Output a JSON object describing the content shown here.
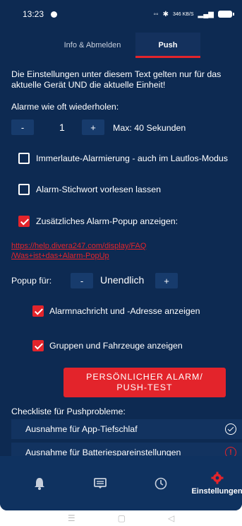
{
  "statusbar": {
    "time": "13:23",
    "network_speed": "346 KB/S"
  },
  "tabs": [
    {
      "label": "Info & Abmelden"
    },
    {
      "label": "Push"
    }
  ],
  "intro_text": "Die Einstellungen unter diesem Text gelten nur für das aktuelle Gerät UND die aktuelle Einheit!",
  "repeat": {
    "label": "Alarme wie oft wiederholen:",
    "minus_label": "-",
    "value": "1",
    "plus_label": "+",
    "max_text": "Max: 40 Sekunden"
  },
  "options": [
    {
      "label": "Immerlaute-Alarmierung - auch im Lautlos-Modus",
      "checked": false
    },
    {
      "label": "Alarm-Stichwort vorlesen lassen",
      "checked": false
    },
    {
      "label": "Zusätzliches Alarm-Popup anzeigen:",
      "checked": true
    }
  ],
  "help_link": "https://help.divera247.com/display/FAQ/Was+ist+das+Alarm-PopUp",
  "help_link_line1": "https://help.divera247.com/display/FAQ",
  "help_link_line2": "/Was+ist+das+Alarm-PopUp",
  "popup": {
    "label": "Popup für:",
    "minus_label": "-",
    "value": "Unendlich",
    "plus_label": "+"
  },
  "popup_options": [
    {
      "label": "Alarmnachricht und -Adresse anzeigen",
      "checked": true
    },
    {
      "label": "Gruppen und Fahrzeuge anzeigen",
      "checked": true
    }
  ],
  "test_button": {
    "line1": "PERSÖNLICHER ALARM/",
    "line2": "PUSH-TEST"
  },
  "checklist": {
    "title": "Checkliste für Pushprobleme:",
    "items": [
      {
        "label": "Ausnahme für App-Tiefschlaf",
        "status": "ok"
      },
      {
        "label": "Ausnahme für Batteriespareinstellungen",
        "status": "warning",
        "status_glyph": "!"
      }
    ]
  },
  "bottomnav": {
    "items": [
      {
        "icon": "bell-icon"
      },
      {
        "icon": "message-icon"
      },
      {
        "icon": "clock-icon"
      },
      {
        "icon": "gear-icon",
        "label": "Einstellungen",
        "active": true
      }
    ]
  },
  "colors": {
    "background": "#0d2a52",
    "accent": "#e3242b",
    "nav": "#0f3260"
  }
}
